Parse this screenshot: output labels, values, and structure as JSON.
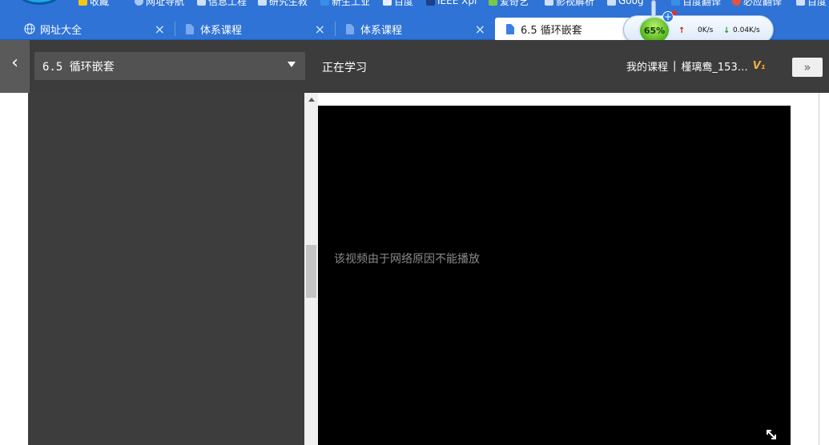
{
  "browser": {
    "bookmarks": [
      "收藏",
      "网址导航",
      "信息工程",
      "研究生教",
      "新生工业",
      "百度",
      "IEEE Xpl",
      "爱奇艺",
      "影视解析",
      "Goog",
      "百度翻译",
      "必应翻译",
      "百度"
    ],
    "tabs": [
      {
        "label": "网址大全",
        "icon": "globe-icon",
        "active": false
      },
      {
        "label": "体系课程",
        "icon": "document-icon",
        "active": false
      },
      {
        "label": "体系课程",
        "icon": "document-icon",
        "active": false
      },
      {
        "label": "6.5 循环嵌套",
        "icon": "document-icon",
        "active": true
      }
    ],
    "close_glyph": "×"
  },
  "net_widget": {
    "percent": "65%",
    "upload": "0K/s",
    "download": "0.04K/s",
    "plus": "+",
    "up_arrow": "↑",
    "down_arrow": "↓"
  },
  "header": {
    "back_icon": "‹",
    "chapter_select": "6.5 循环嵌套",
    "studying": "正在学习",
    "my_courses": "我的课程",
    "divider": "|",
    "username": "槿璃鸯_153…",
    "vip_badge": "V₁",
    "collapse_label": "»"
  },
  "video": {
    "message": "该视频由于网络原因不能播放"
  },
  "colors": {
    "tab_bar": "#2f73d6",
    "header_bg": "#3c3c3c",
    "panel_bg": "#3d3d3d",
    "video_bg": "#000000",
    "vip": "#f0b13a"
  }
}
